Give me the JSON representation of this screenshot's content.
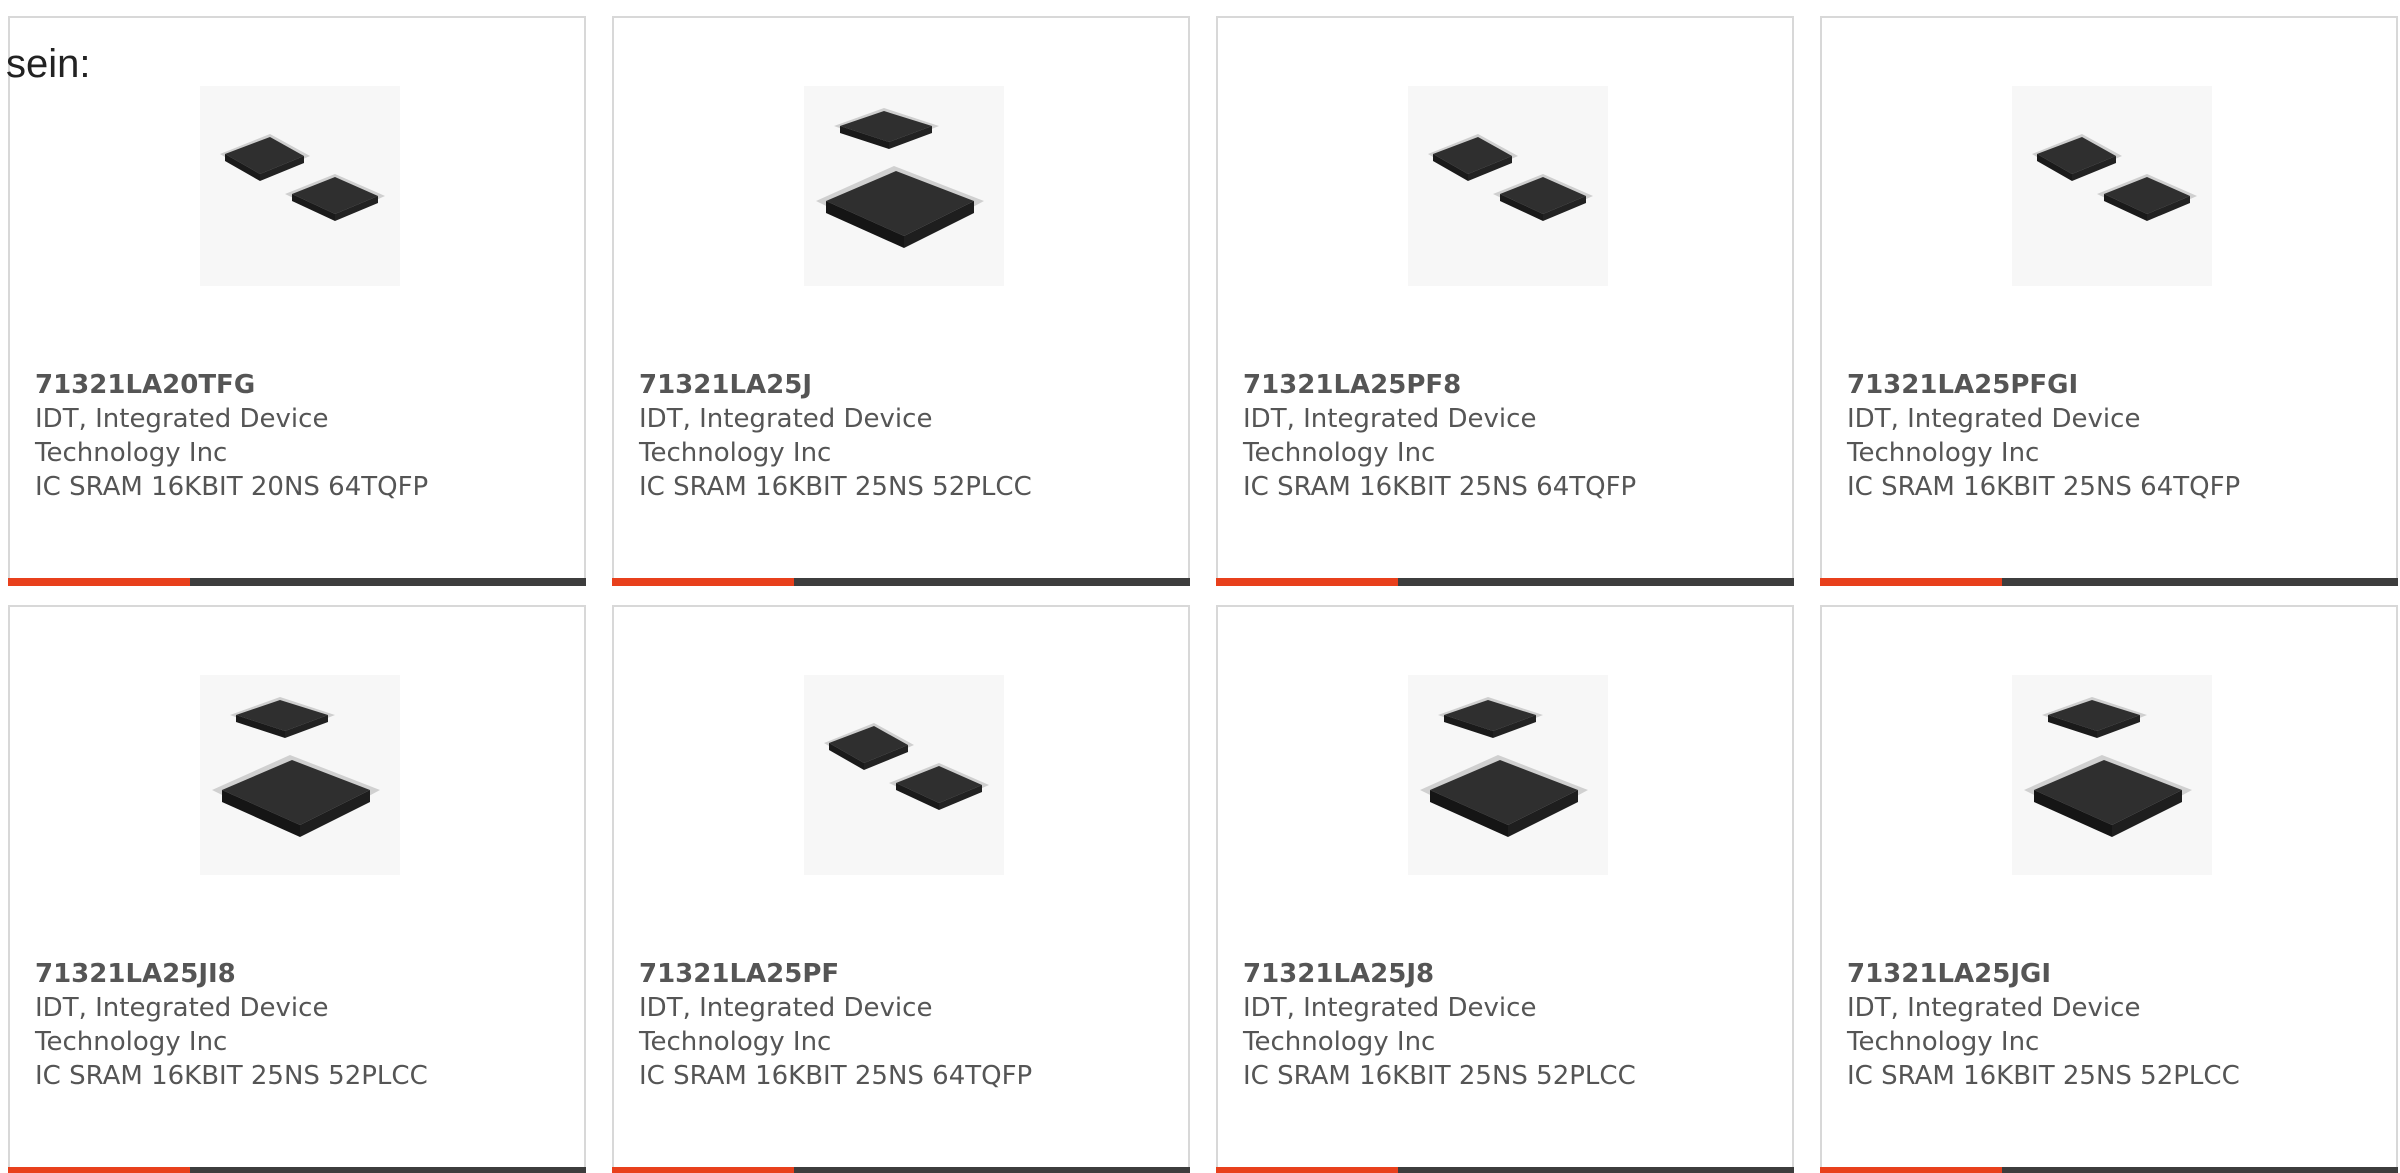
{
  "intro_text": "sein:",
  "accent_color": "#e8401c",
  "bar_color": "#3d3d3d",
  "products": [
    {
      "part": "71321LA20TFG",
      "maker_line1": "IDT, Integrated Device",
      "maker_line2": "Technology Inc",
      "desc": "IC SRAM 16KBIT 20NS 64TQFP",
      "image": "tqfp-chip-icon"
    },
    {
      "part": "71321LA25J",
      "maker_line1": "IDT, Integrated Device",
      "maker_line2": "Technology Inc",
      "desc": "IC SRAM 16KBIT 25NS 52PLCC",
      "image": "plcc-chip-icon"
    },
    {
      "part": "71321LA25PF8",
      "maker_line1": "IDT, Integrated Device",
      "maker_line2": "Technology Inc",
      "desc": "IC SRAM 16KBIT 25NS 64TQFP",
      "image": "tqfp-chip-icon"
    },
    {
      "part": "71321LA25PFGI",
      "maker_line1": "IDT, Integrated Device",
      "maker_line2": "Technology Inc",
      "desc": "IC SRAM 16KBIT 25NS 64TQFP",
      "image": "tqfp-chip-icon"
    },
    {
      "part": "71321LA25JI8",
      "maker_line1": "IDT, Integrated Device",
      "maker_line2": "Technology Inc",
      "desc": "IC SRAM 16KBIT 25NS 52PLCC",
      "image": "plcc-chip-icon"
    },
    {
      "part": "71321LA25PF",
      "maker_line1": "IDT, Integrated Device",
      "maker_line2": "Technology Inc",
      "desc": "IC SRAM 16KBIT 25NS 64TQFP",
      "image": "tqfp-chip-icon"
    },
    {
      "part": "71321LA25J8",
      "maker_line1": "IDT, Integrated Device",
      "maker_line2": "Technology Inc",
      "desc": "IC SRAM 16KBIT 25NS 52PLCC",
      "image": "plcc-chip-icon"
    },
    {
      "part": "71321LA25JGI",
      "maker_line1": "IDT, Integrated Device",
      "maker_line2": "Technology Inc",
      "desc": "IC SRAM 16KBIT 25NS 52PLCC",
      "image": "plcc-chip-icon"
    }
  ]
}
